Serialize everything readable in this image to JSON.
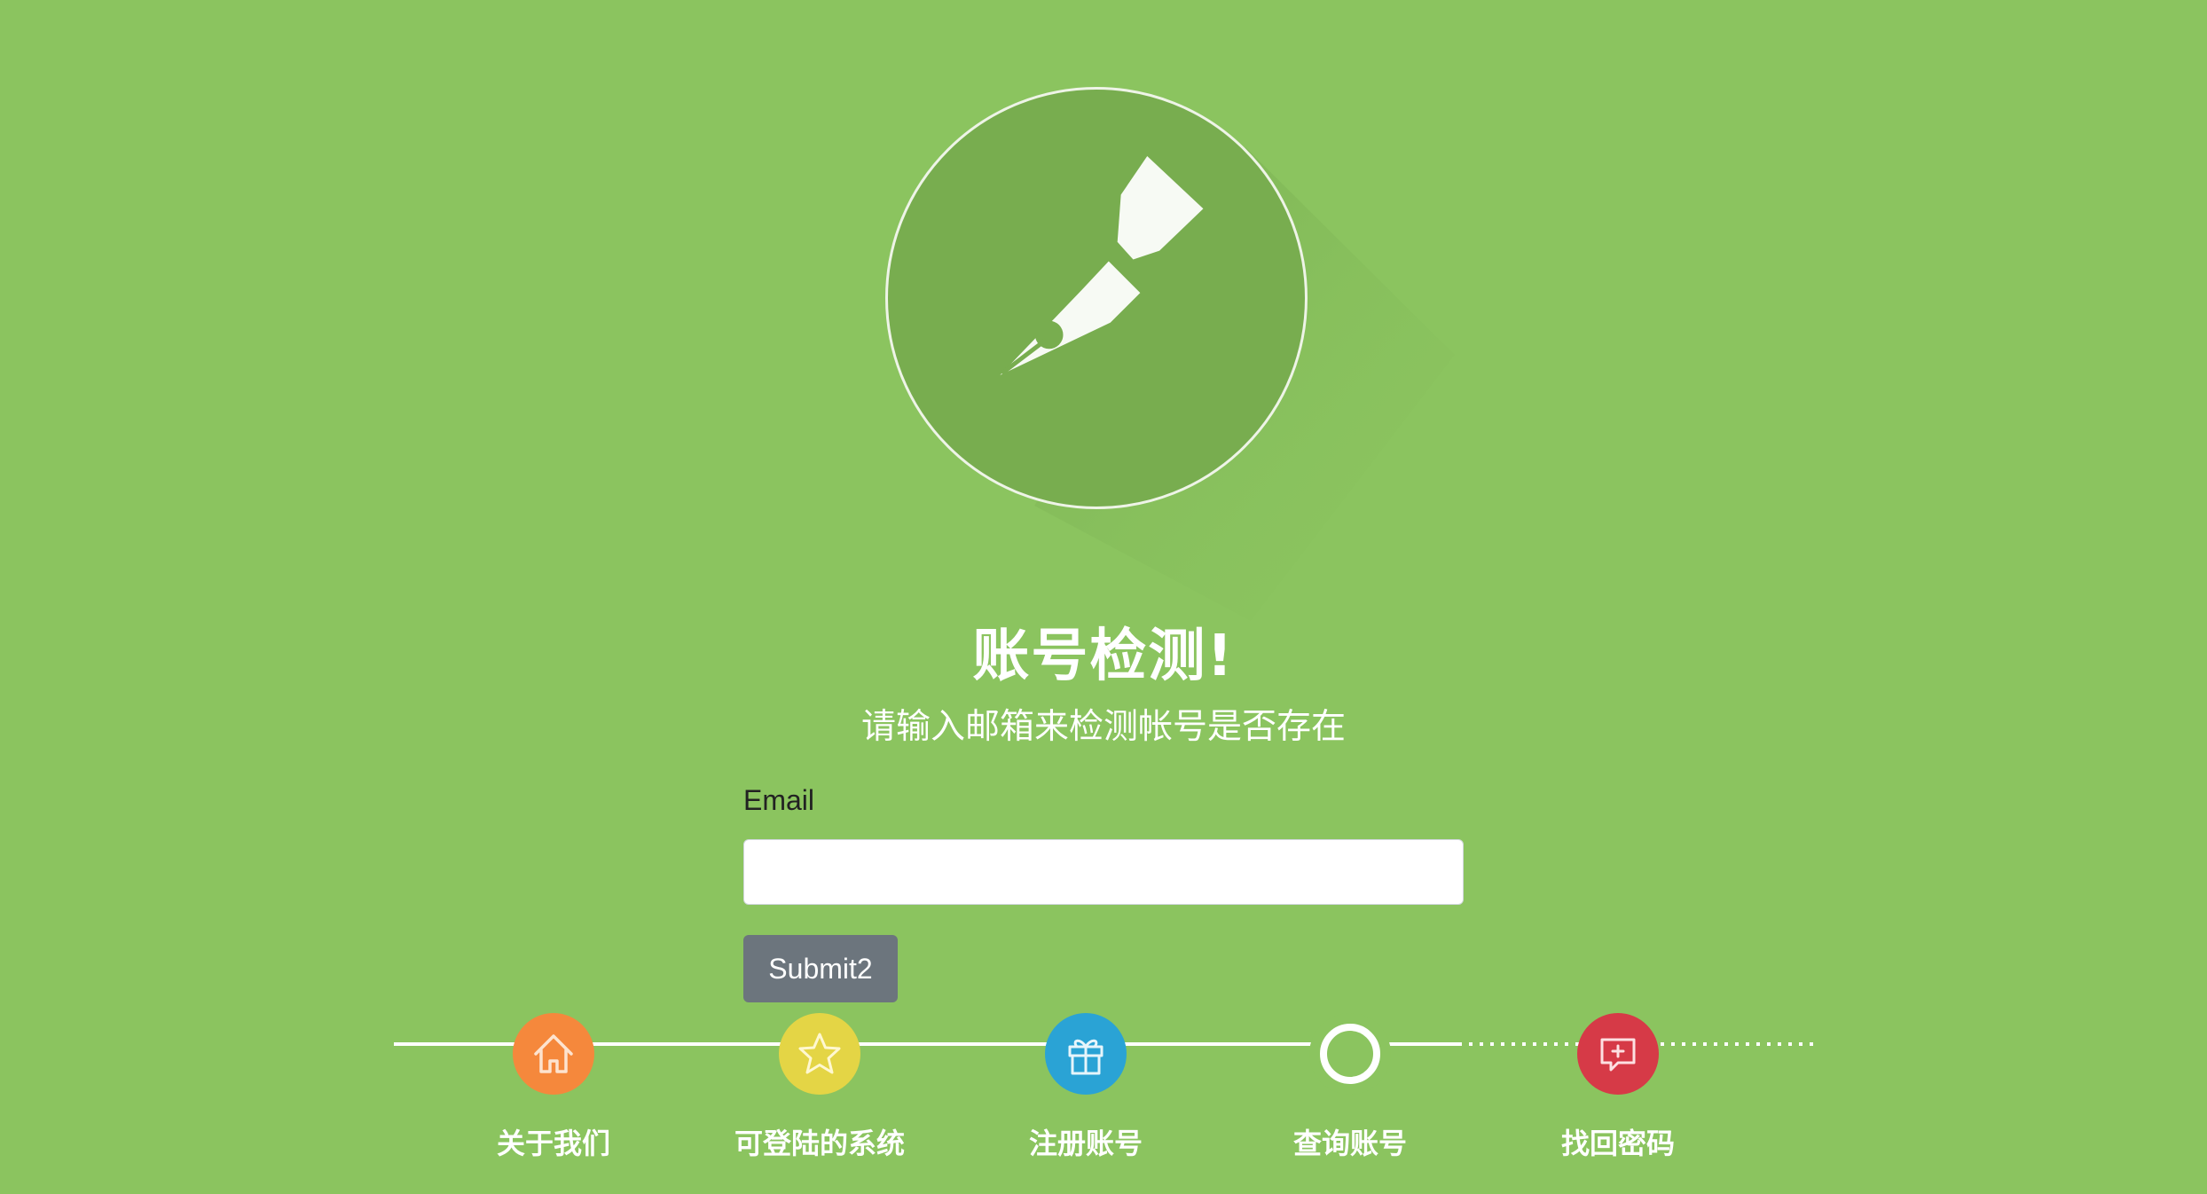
{
  "header": {
    "title": "账号检测!",
    "subtitle": "请输入邮箱来检测帐号是否存在"
  },
  "form": {
    "email_label": "Email",
    "email_value": "",
    "email_placeholder": "",
    "submit_label": "Submit2"
  },
  "nav": {
    "items": [
      {
        "label": "关于我们",
        "icon": "home-icon",
        "color": "#f5883c"
      },
      {
        "label": "可登陆的系统",
        "icon": "star-icon",
        "color": "#e4d545"
      },
      {
        "label": "注册账号",
        "icon": "gift-icon",
        "color": "#2aa3d5"
      },
      {
        "label": "查询账号",
        "icon": "ring-icon",
        "color": "#ffffff"
      },
      {
        "label": "找回密码",
        "icon": "chat-plus-icon",
        "color": "#d63a47"
      }
    ]
  },
  "colors": {
    "background": "#8bc45f",
    "emblem": "#78ad4f",
    "button": "#6c757d"
  }
}
